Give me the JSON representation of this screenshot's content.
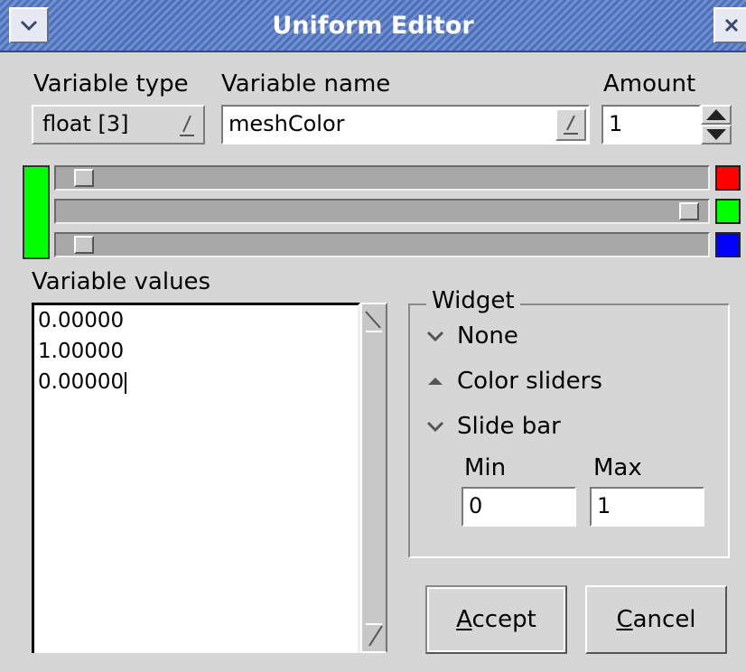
{
  "window": {
    "title": "Uniform Editor",
    "menu_icon": "chevron-down-icon",
    "close_icon": "close-icon"
  },
  "variable_type": {
    "label": "Variable type",
    "value": "float [3]"
  },
  "variable_name": {
    "label": "Variable name",
    "value": "meshColor"
  },
  "amount": {
    "label": "Amount",
    "value": "1"
  },
  "color_preview": {
    "color": "#00ff00"
  },
  "sliders": [
    {
      "channel": "red",
      "color": "#ff0000",
      "level": 0.0
    },
    {
      "channel": "green",
      "color": "#00ff00",
      "level": 1.0
    },
    {
      "channel": "blue",
      "color": "#0000ff",
      "level": 0.0
    }
  ],
  "values": {
    "label": "Variable values",
    "lines": [
      "0.00000",
      "1.00000",
      "0.00000"
    ]
  },
  "widget": {
    "label": "Widget",
    "options": [
      {
        "label": "None",
        "selected": false
      },
      {
        "label": "Color sliders",
        "selected": true
      },
      {
        "label": "Slide bar",
        "selected": false
      }
    ],
    "min_label": "Min",
    "max_label": "Max",
    "min_value": "0",
    "max_value": "1"
  },
  "buttons": {
    "accept_mnemonic": "A",
    "accept_rest": "ccept",
    "cancel_mnemonic": "C",
    "cancel_rest": "ancel"
  }
}
